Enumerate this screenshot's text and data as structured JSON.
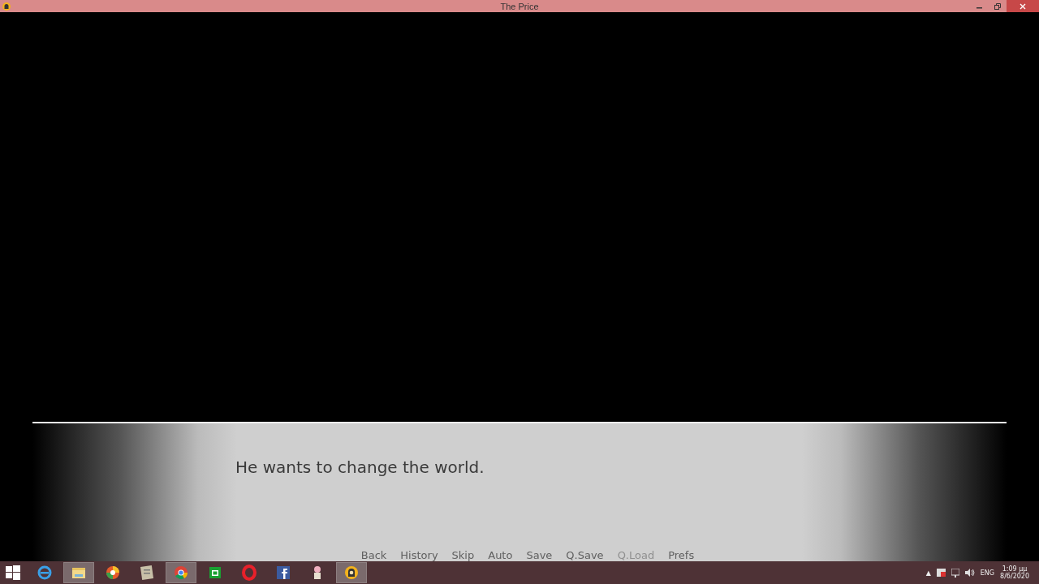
{
  "window": {
    "title": "The Price"
  },
  "dialogue": {
    "text": "He wants to change the world."
  },
  "quick_menu": [
    {
      "label": "Back",
      "disabled": false
    },
    {
      "label": "History",
      "disabled": false
    },
    {
      "label": "Skip",
      "disabled": false
    },
    {
      "label": "Auto",
      "disabled": false
    },
    {
      "label": "Save",
      "disabled": false
    },
    {
      "label": "Q.Save",
      "disabled": false
    },
    {
      "label": "Q.Load",
      "disabled": true
    },
    {
      "label": "Prefs",
      "disabled": false
    }
  ],
  "taskbar": {
    "apps": [
      {
        "kind": "ie",
        "highlighted": false
      },
      {
        "kind": "folder",
        "highlighted": true
      },
      {
        "kind": "disc",
        "highlighted": false
      },
      {
        "kind": "notes",
        "highlighted": false
      },
      {
        "kind": "chrome",
        "highlighted": true
      },
      {
        "kind": "store",
        "highlighted": false
      },
      {
        "kind": "opera",
        "highlighted": false
      },
      {
        "kind": "facebook",
        "highlighted": false
      },
      {
        "kind": "character",
        "highlighted": false
      },
      {
        "kind": "game",
        "highlighted": true
      }
    ],
    "tray": {
      "caret": "▲",
      "language": "ENG",
      "time": "1:09 μμ",
      "date": "8/6/2020"
    }
  }
}
